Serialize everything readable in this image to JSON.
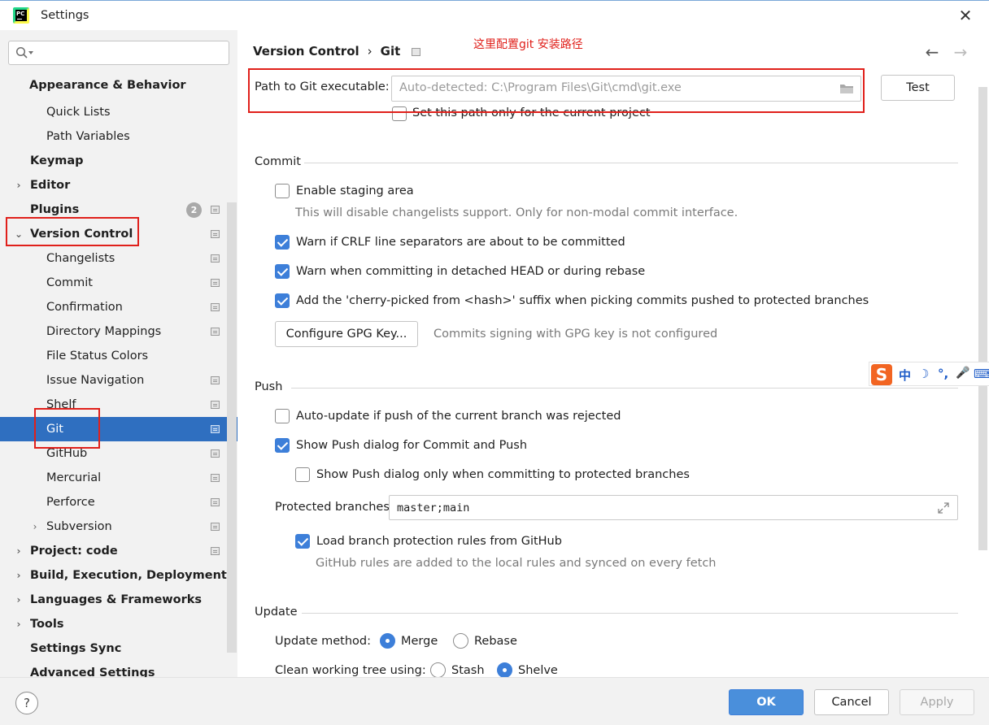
{
  "window": {
    "title": "Settings"
  },
  "search": {
    "placeholder": ""
  },
  "sidebar": {
    "items": [
      {
        "label": "Appearance & Behavior"
      },
      {
        "label": "Quick Lists"
      },
      {
        "label": "Path Variables"
      },
      {
        "label": "Keymap"
      },
      {
        "label": "Editor"
      },
      {
        "label": "Plugins",
        "badge": "2"
      },
      {
        "label": "Version Control"
      },
      {
        "label": "Changelists"
      },
      {
        "label": "Commit"
      },
      {
        "label": "Confirmation"
      },
      {
        "label": "Directory Mappings"
      },
      {
        "label": "File Status Colors"
      },
      {
        "label": "Issue Navigation"
      },
      {
        "label": "Shelf"
      },
      {
        "label": "Git"
      },
      {
        "label": "GitHub"
      },
      {
        "label": "Mercurial"
      },
      {
        "label": "Perforce"
      },
      {
        "label": "Subversion"
      },
      {
        "label": "Project: code"
      },
      {
        "label": "Build, Execution, Deployment"
      },
      {
        "label": "Languages & Frameworks"
      },
      {
        "label": "Tools"
      },
      {
        "label": "Settings Sync"
      },
      {
        "label": "Advanced Settings"
      }
    ]
  },
  "breadcrumb": {
    "parent": "Version Control",
    "separator": "›",
    "current": "Git"
  },
  "annotation": "这里配置git 安装路径",
  "git_path": {
    "label": "Path to Git executable:",
    "placeholder": "Auto-detected: C:\\Program Files\\Git\\cmd\\git.exe",
    "test_button": "Test",
    "current_project_only": "Set this path only for the current project"
  },
  "commit": {
    "title": "Commit",
    "enable_staging": "Enable staging area",
    "enable_staging_hint": "This will disable changelists support. Only for non-modal commit interface.",
    "warn_crlf": "Warn if CRLF line separators are about to be committed",
    "warn_detached": "Warn when committing in detached HEAD or during rebase",
    "cherry_pick": "Add the 'cherry-picked from <hash>' suffix when picking commits pushed to protected branches",
    "gpg_button": "Configure GPG Key...",
    "gpg_status": "Commits signing with GPG key is not configured"
  },
  "push": {
    "title": "Push",
    "auto_update": "Auto-update if push of the current branch was rejected",
    "show_push_dialog": "Show Push dialog for Commit and Push",
    "show_push_protected": "Show Push dialog only when committing to protected branches",
    "protected_label": "Protected branches:",
    "protected_value": "master;main",
    "load_rules": "Load branch protection rules from GitHub",
    "load_rules_hint": "GitHub rules are added to the local rules and synced on every fetch"
  },
  "update": {
    "title": "Update",
    "method_label": "Update method:",
    "merge": "Merge",
    "rebase": "Rebase",
    "clean_label": "Clean working tree using:",
    "stash": "Stash",
    "shelve": "Shelve"
  },
  "ime": {
    "chars": [
      "中",
      "☽",
      "°,",
      "🎤",
      "⌨"
    ]
  },
  "footer": {
    "help": "?",
    "ok": "OK",
    "cancel": "Cancel",
    "apply": "Apply"
  },
  "colors": {
    "accent": "#3d7fd9",
    "selection": "#2f6fc0",
    "highlight_red": "#e0201b"
  }
}
